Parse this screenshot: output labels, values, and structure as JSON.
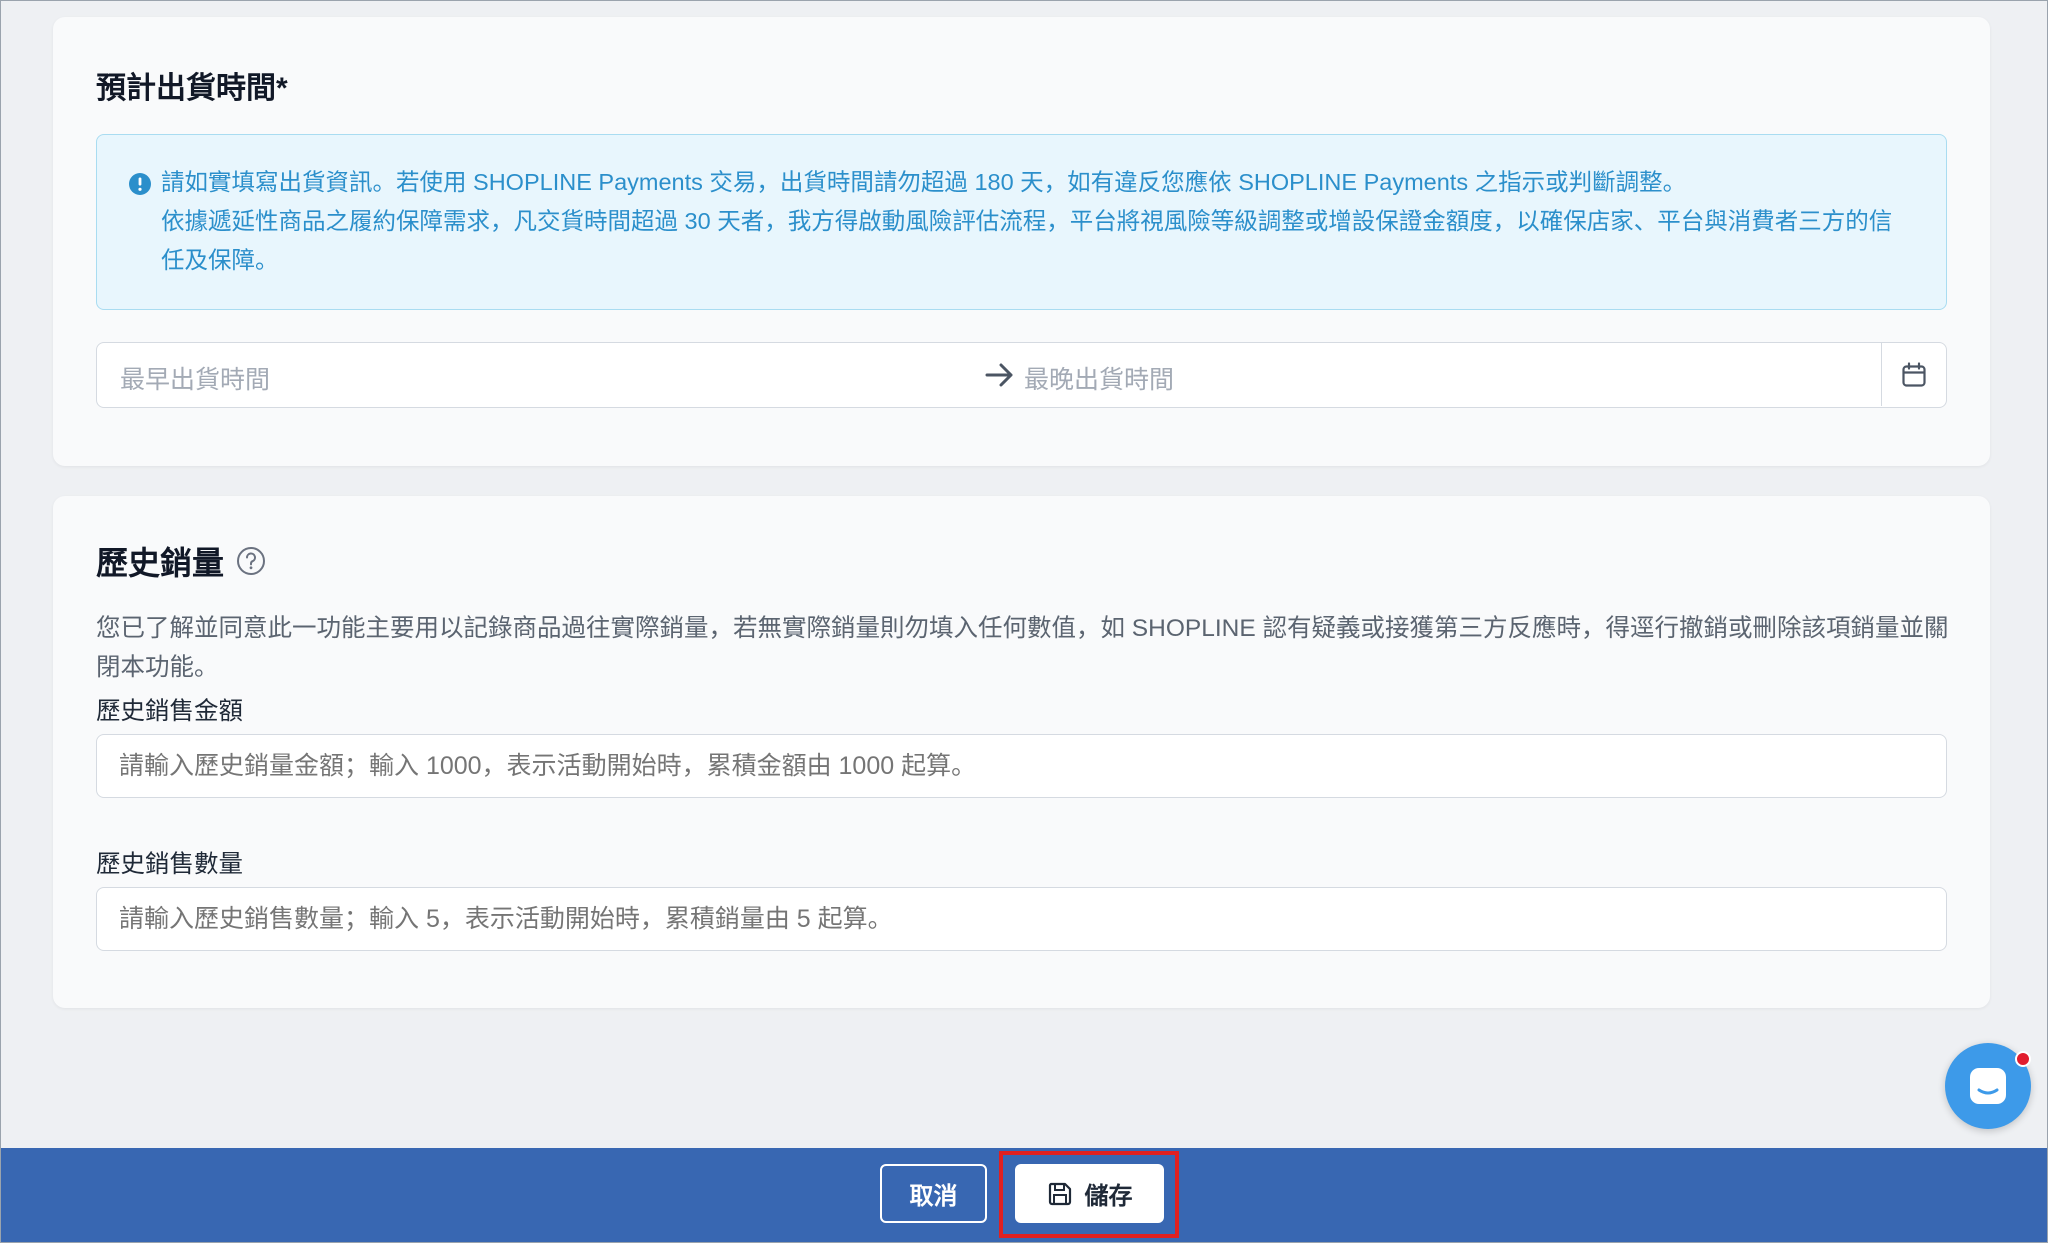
{
  "shipping": {
    "title": "預計出貨時間*",
    "notice_line1": "請如實填寫出貨資訊。若使用 SHOPLINE Payments 交易，出貨時間請勿超過 180 天，如有違反您應依 SHOPLINE Payments 之指示或判斷調整。",
    "notice_line2": "依據遞延性商品之履約保障需求，凡交貨時間超過 30 天者，我方得啟動風險評估流程，平台將視風險等級調整或增設保證金額度，以確保店家、平台與消費者三方的信任及保障。",
    "start_placeholder": "最早出貨時間",
    "end_placeholder": "最晚出貨時間",
    "icons": {
      "notice": "info-circle-icon",
      "arrow": "arrow-right-icon",
      "calendar": "calendar-icon"
    }
  },
  "sales_history": {
    "title": "歷史銷量",
    "description": "您已了解並同意此一功能主要用以記錄商品過往實際銷量，若無實際銷量則勿填入任何數值，如 SHOPLINE 認有疑義或接獲第三方反應時，得逕行撤銷或刪除該項銷量並關閉本功能。",
    "amount_label": "歷史銷售金額",
    "amount_placeholder": "請輸入歷史銷量金額；輸入 1000，表示活動開始時，累積金額由 1000 起算。",
    "quantity_label": "歷史銷售數量",
    "quantity_placeholder": "請輸入歷史銷售數量；輸入 5，表示活動開始時，累積銷量由 5 起算。",
    "icons": {
      "help": "question-circle-icon"
    }
  },
  "footer": {
    "cancel_label": "取消",
    "save_label": "儲存",
    "icons": {
      "save": "floppy-disk-icon"
    }
  },
  "colors": {
    "notice_text": "#2b8fcb",
    "notice_bg": "#e8f6fd",
    "footer_bar": "#3867b2",
    "chat_button": "#3d9ae9",
    "highlight": "#e02020"
  }
}
